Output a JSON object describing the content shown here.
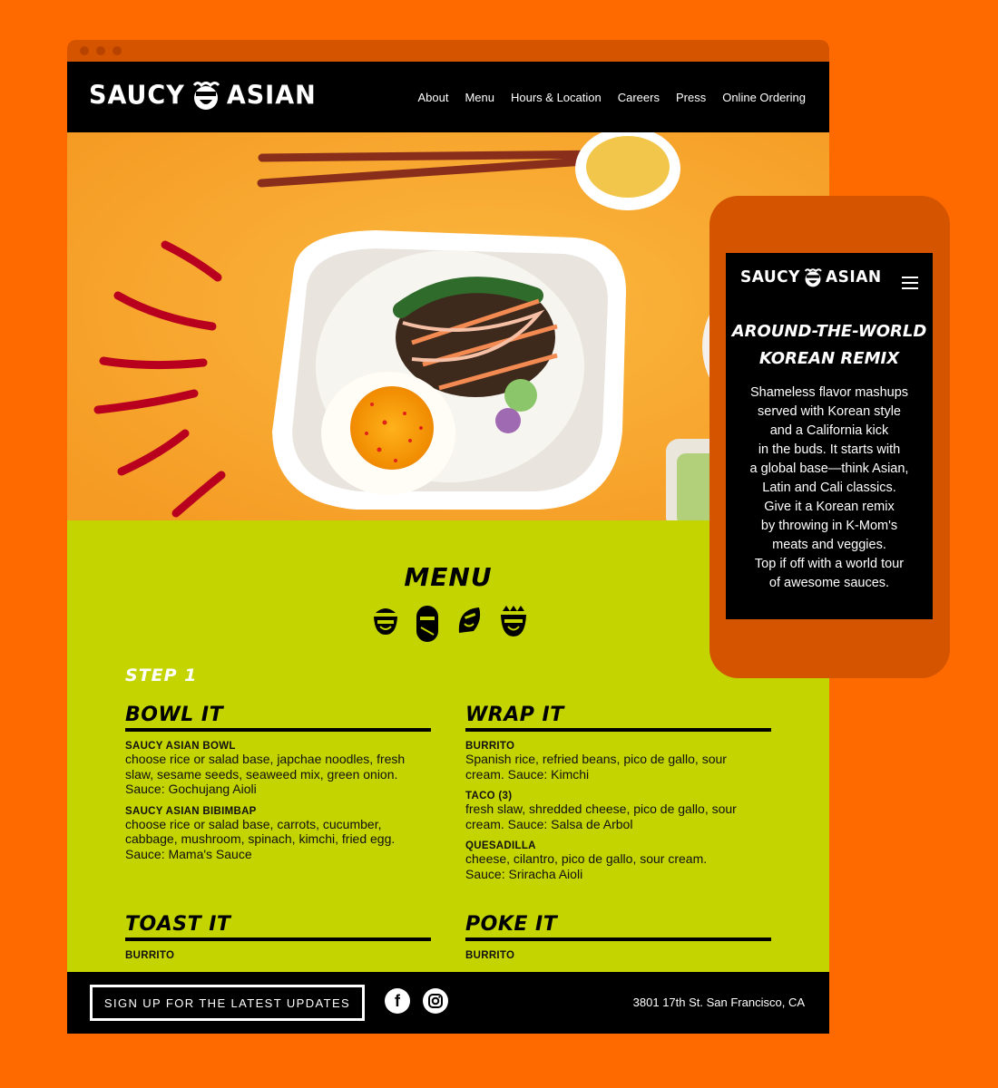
{
  "brand": {
    "name_left": "SAUCY",
    "name_right": "ASIAN"
  },
  "nav": [
    {
      "label": "About"
    },
    {
      "label": "Menu"
    },
    {
      "label": "Hours & Location"
    },
    {
      "label": "Careers"
    },
    {
      "label": "Press"
    },
    {
      "label": "Online Ordering"
    }
  ],
  "menu": {
    "title": "MENU",
    "icons": [
      "rice-bowl-icon",
      "burrito-icon",
      "taco-icon",
      "poke-bowl-icon"
    ],
    "step": "STEP 1",
    "columns": [
      {
        "title": "BOWL IT",
        "items": [
          {
            "name": "SAUCY ASIAN BOWL",
            "desc": "choose rice or salad base, japchae noodles, fresh slaw, sesame seeds, seaweed mix, green onion. Sauce: Gochujang Aioli"
          },
          {
            "name": "SAUCY ASIAN BIBIMBAP",
            "desc": "choose rice or salad base, carrots, cucumber, cabbage, mushroom, spinach, kimchi, fried egg. Sauce: Mama's Sauce"
          }
        ]
      },
      {
        "title": "WRAP IT",
        "items": [
          {
            "name": "BURRITO",
            "desc": "Spanish rice, refried beans, pico de gallo, sour cream. Sauce: Kimchi"
          },
          {
            "name": "TACO (3)",
            "desc": "fresh slaw, shredded cheese, pico de gallo, sour cream. Sauce: Salsa de Arbol"
          },
          {
            "name": "QUESADILLA",
            "desc": "cheese, cilantro, pico de gallo, sour cream. Sauce: Sriracha Aioli"
          }
        ]
      },
      {
        "title": "TOAST IT",
        "items": [
          {
            "name": "BURRITO"
          }
        ]
      },
      {
        "title": "POKE IT",
        "items": [
          {
            "name": "BURRITO"
          }
        ]
      }
    ]
  },
  "footer": {
    "signup_label": "SIGN UP FOR THE LATEST UPDATES",
    "address": "3801 17th St. San Francisco, CA",
    "social": [
      "facebook-icon",
      "instagram-icon"
    ]
  },
  "mobile": {
    "headline_line1": "AROUND-THE-WORLD",
    "headline_line2": "KOREAN REMIX",
    "body_lines": [
      "Shameless flavor mashups",
      "served with Korean style",
      "and a California kick",
      "in the buds. It starts with",
      "a global base—think Asian,",
      "Latin and Cali classics.",
      "Give it a Korean remix",
      "by throwing in K-Mom's",
      "meats and veggies.",
      "Top if off with a world tour",
      "of awesome sauces."
    ]
  },
  "colors": {
    "background": "#ff6a00",
    "menu_bg": "#c3d400",
    "hero_bg": "#f9aa34",
    "phone": "#d45400",
    "black": "#000000"
  }
}
